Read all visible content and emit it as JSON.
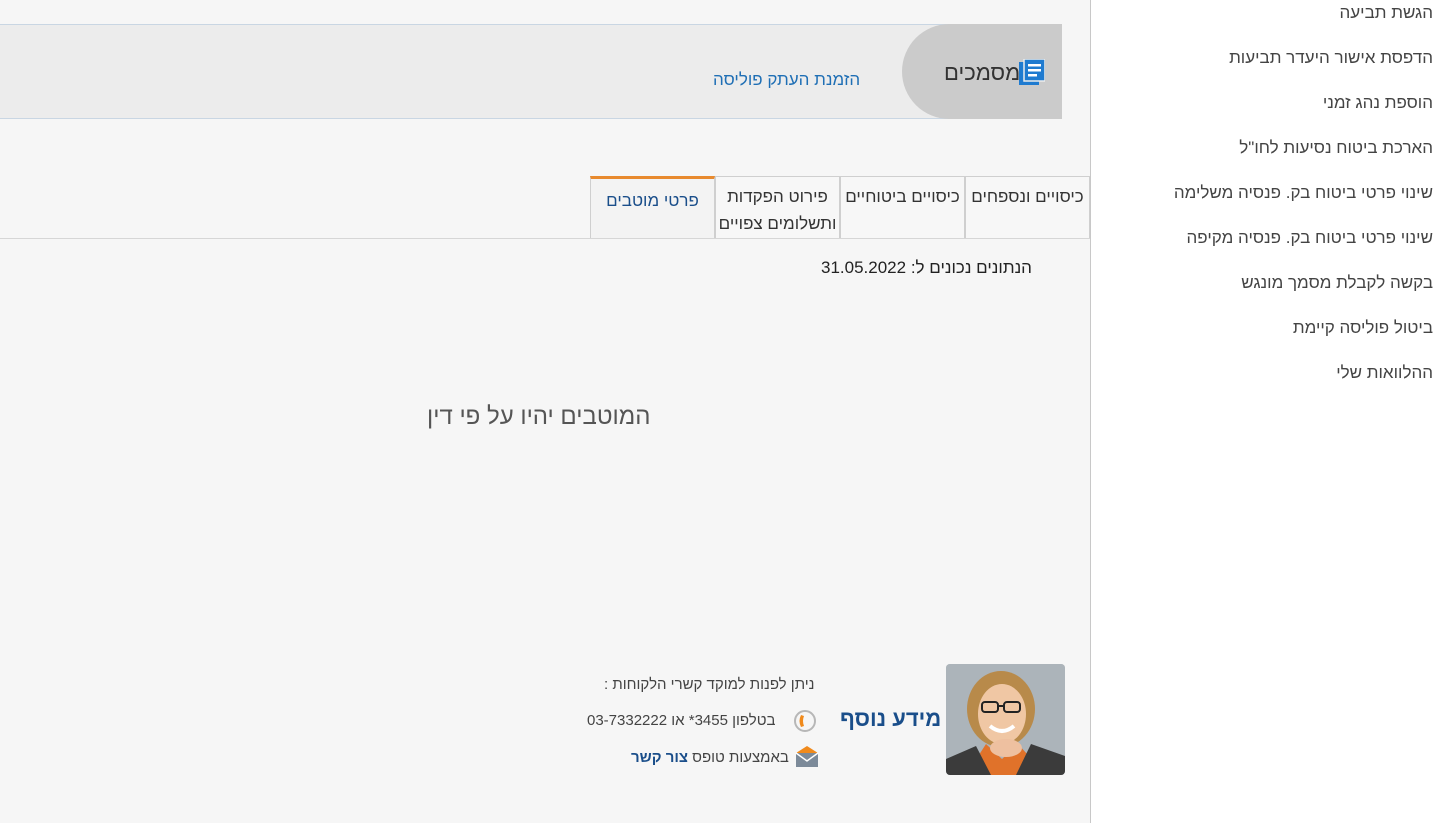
{
  "side_menu": {
    "items": [
      "הגשת תביעה",
      "הדפסת אישור היעדר תביעות",
      "הוספת נהג זמני",
      "הארכת ביטוח נסיעות לחו\"ל",
      "שינוי פרטי ביטוח בק. פנסיה משלימה",
      "שינוי פרטי ביטוח בק. פנסיה מקיפה",
      "בקשה לקבלת מסמך מונגש",
      "ביטול פוליסה קיימת",
      "ההלוואות שלי"
    ]
  },
  "documents": {
    "title": "מסמכים",
    "icon": "document-icon",
    "order_copy_link": "הזמנת העתק פוליסה"
  },
  "tabs": [
    {
      "label": "כיסויים ונספחים",
      "active": false
    },
    {
      "label": "כיסויים ביטוחיים",
      "active": false
    },
    {
      "label_line1": "פירוט הפקדות",
      "label_line2": "ותשלומים צפויים",
      "active": false
    },
    {
      "label": "פרטי מוטבים",
      "active": true
    }
  ],
  "content": {
    "as_of_label": "הנתונים נכונים ל:",
    "as_of_date": "31.05.2022",
    "beneficiaries_message": "המוטבים יהיו על פי דין"
  },
  "more_info": {
    "title": "מידע נוסף",
    "intro": "ניתן לפנות למוקד קשרי הלקוחות :",
    "phone_text": "בטלפון 3455* או 03-7332222",
    "form_text": "באמצעות טופס",
    "contact_link": "צור קשר",
    "phone_icon": "phone-icon",
    "mail_icon": "mail-icon",
    "avatar": "customer-service-avatar"
  },
  "colors": {
    "link_blue": "#1f6fb5",
    "dark_blue": "#1a4e8a",
    "active_tab_accent": "#e88a2e",
    "doc_icon": "#1f7bd0"
  }
}
